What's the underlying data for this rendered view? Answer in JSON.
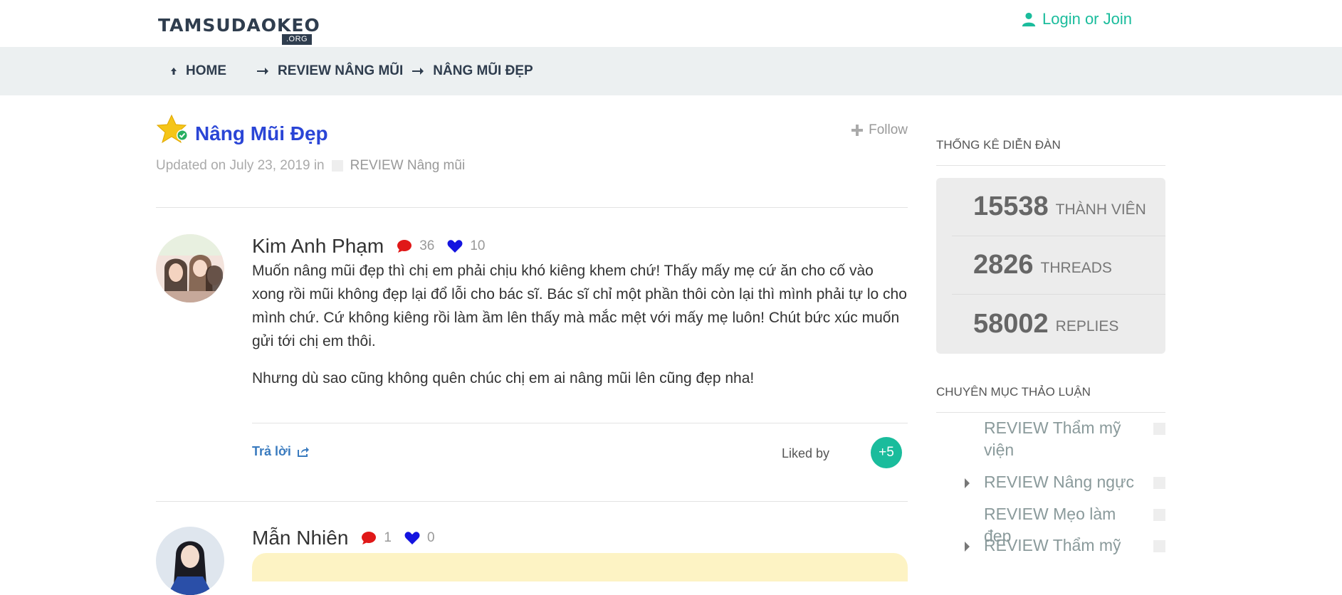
{
  "header": {
    "logo_main": "TAMSUDAOKEO",
    "logo_sub": ".ORG",
    "login_label": "Login or Join"
  },
  "breadcrumb": {
    "items": [
      "HOME",
      "REVIEW NÂNG MŨI",
      "NÂNG MŨI ĐẸP"
    ]
  },
  "topic": {
    "title": "Nâng Mũi Đẹp",
    "follow_label": "Follow",
    "meta_prefix": "Updated on July 23, 2019 in",
    "category": "REVIEW Nâng mũi"
  },
  "posts": [
    {
      "author": "Kim Anh Phạm",
      "comments": "36",
      "likes": "10",
      "paragraphs": [
        "Muốn nâng mũi đẹp thì chị em phải chịu khó kiêng khem chứ! Thấy mấy mẹ cứ ăn cho cố vào xong rồi mũi không đẹp lại đổ lỗi cho bác sĩ. Bác sĩ chỉ một phần thôi còn lại thì mình phải tự lo cho mình chứ. Cứ không kiêng rồi làm ầm lên thấy mà mắc mệt với mấy mẹ luôn! Chút bức xúc muốn gửi tới chị em thôi.",
        "Nhưng dù sao cũng không quên chúc chị em ai nâng mũi lên cũng đẹp nha!"
      ],
      "reply_label": "Trả lời",
      "liked_by_label": "Liked by",
      "liked_by_count": "+5"
    },
    {
      "author": "Mẫn Nhiên",
      "comments": "1",
      "likes": "0"
    }
  ],
  "sidebar": {
    "stats_heading": "THỐNG KÊ DIỄN ĐÀN",
    "stats": [
      {
        "value": "15538",
        "label": "THÀNH VIÊN"
      },
      {
        "value": "2826",
        "label": "THREADS"
      },
      {
        "value": "58002",
        "label": "REPLIES"
      }
    ],
    "categories_heading": "CHUYÊN MỤC THẢO LUẬN",
    "categories": [
      {
        "label": "REVIEW Thẩm mỹ viện",
        "has_children": false
      },
      {
        "label": "REVIEW Nâng ngực",
        "has_children": true
      },
      {
        "label": "REVIEW Mẹo làm đẹp",
        "has_children": false
      },
      {
        "label": "REVIEW Thẩm mỹ",
        "has_children": true
      }
    ]
  },
  "colors": {
    "accent": "#1abc9c",
    "title_blue": "#2a45d6",
    "dark": "#2f3d4e"
  }
}
